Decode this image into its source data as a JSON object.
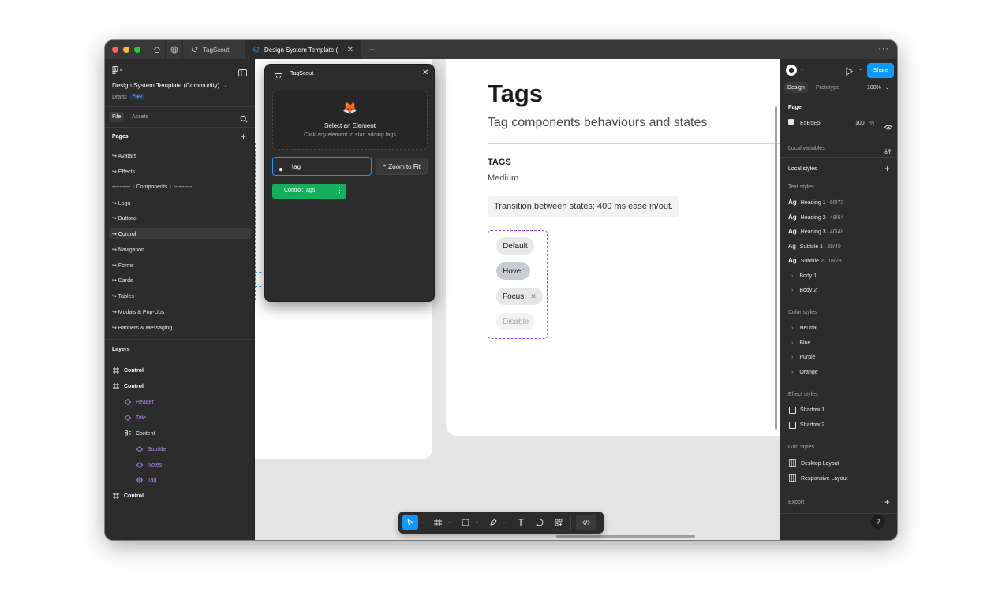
{
  "titlebar": {
    "tabs": [
      {
        "label": "TagScout"
      },
      {
        "label": "Design System Template (Comm"
      }
    ]
  },
  "left_panel": {
    "file_title": "Design System Template (Community)",
    "drafts_label": "Drafts",
    "plan_badge": "Free",
    "tabs": {
      "file": "File",
      "assets": "Assets"
    },
    "pages_heading": "Pages",
    "pages": [
      "↪ Avatars",
      "↪ Effects",
      "---------- ↓ Components ↓ ----------",
      "↪ Logo",
      "↪ Buttons",
      "↪ Control",
      "↪ Navigation",
      "↪ Forms",
      "↪ Cards",
      "↪ Tables",
      "↪ Modals & Pop-Ups",
      "↪ Banners & Messaging"
    ],
    "layers_heading": "Layers",
    "layers": [
      {
        "name": "Control",
        "kind": "frame"
      },
      {
        "name": "Control",
        "kind": "frame"
      },
      {
        "name": "Header",
        "kind": "instance"
      },
      {
        "name": "Title",
        "kind": "instance"
      },
      {
        "name": "Content",
        "kind": "autolayout"
      },
      {
        "name": "Subtitle",
        "kind": "instance"
      },
      {
        "name": "Notes",
        "kind": "instance"
      },
      {
        "name": "Tag",
        "kind": "component-set"
      },
      {
        "name": "Control",
        "kind": "frame"
      }
    ]
  },
  "plugin": {
    "title": "TagScout",
    "emoji": "🦊",
    "select_heading": "Select an Element",
    "select_hint": "Click any element to start adding tags",
    "search_value": "tag",
    "zoom_button": "Zoom to Fit",
    "tag_chip": "Control:Tags"
  },
  "canvas": {
    "title": "Tags",
    "subtitle": "Tag components behaviours and states.",
    "section_heading": "TAGS",
    "section_size": "Medium",
    "note": "Transition between states: 400 ms ease in/out.",
    "states": [
      {
        "label": "Default"
      },
      {
        "label": "Hover"
      },
      {
        "label": "Focus",
        "closable": true
      },
      {
        "label": "Disable"
      }
    ]
  },
  "right_panel": {
    "share_label": "Share",
    "tabs": {
      "design": "Design",
      "prototype": "Prototype"
    },
    "zoom": "100%",
    "page_heading": "Page",
    "page_color": "E5E5E5",
    "page_opacity": "100",
    "percent": "%",
    "local_variables": "Local variables",
    "local_styles": "Local styles",
    "text_styles_heading": "Text styles",
    "text_styles": [
      {
        "name": "Heading 1",
        "spec": " · 60/72"
      },
      {
        "name": "Heading 2",
        "spec": " · 48/64"
      },
      {
        "name": "Heading 3",
        "spec": " · 40/48"
      },
      {
        "name": "Subtitle 1",
        "spec": " · 28/40"
      },
      {
        "name": "Subtitle 2",
        "spec": " · 18/28"
      }
    ],
    "text_groups": [
      "Body 1",
      "Body 2"
    ],
    "color_styles_heading": "Color styles",
    "color_groups": [
      "Neutral",
      "Blue",
      "Purple",
      "Orange"
    ],
    "effect_styles_heading": "Effect styles",
    "effect_styles": [
      "Shadow 1",
      "Shadow 2"
    ],
    "grid_styles_heading": "Grid styles",
    "grid_styles": [
      "Desktop Layout",
      "Responsive Layout"
    ],
    "export_label": "Export",
    "help": "?"
  },
  "colors": {
    "accent_blue": "#0d99ff",
    "plugin_green": "#14ae5c",
    "component_purple": "#9747ff"
  }
}
